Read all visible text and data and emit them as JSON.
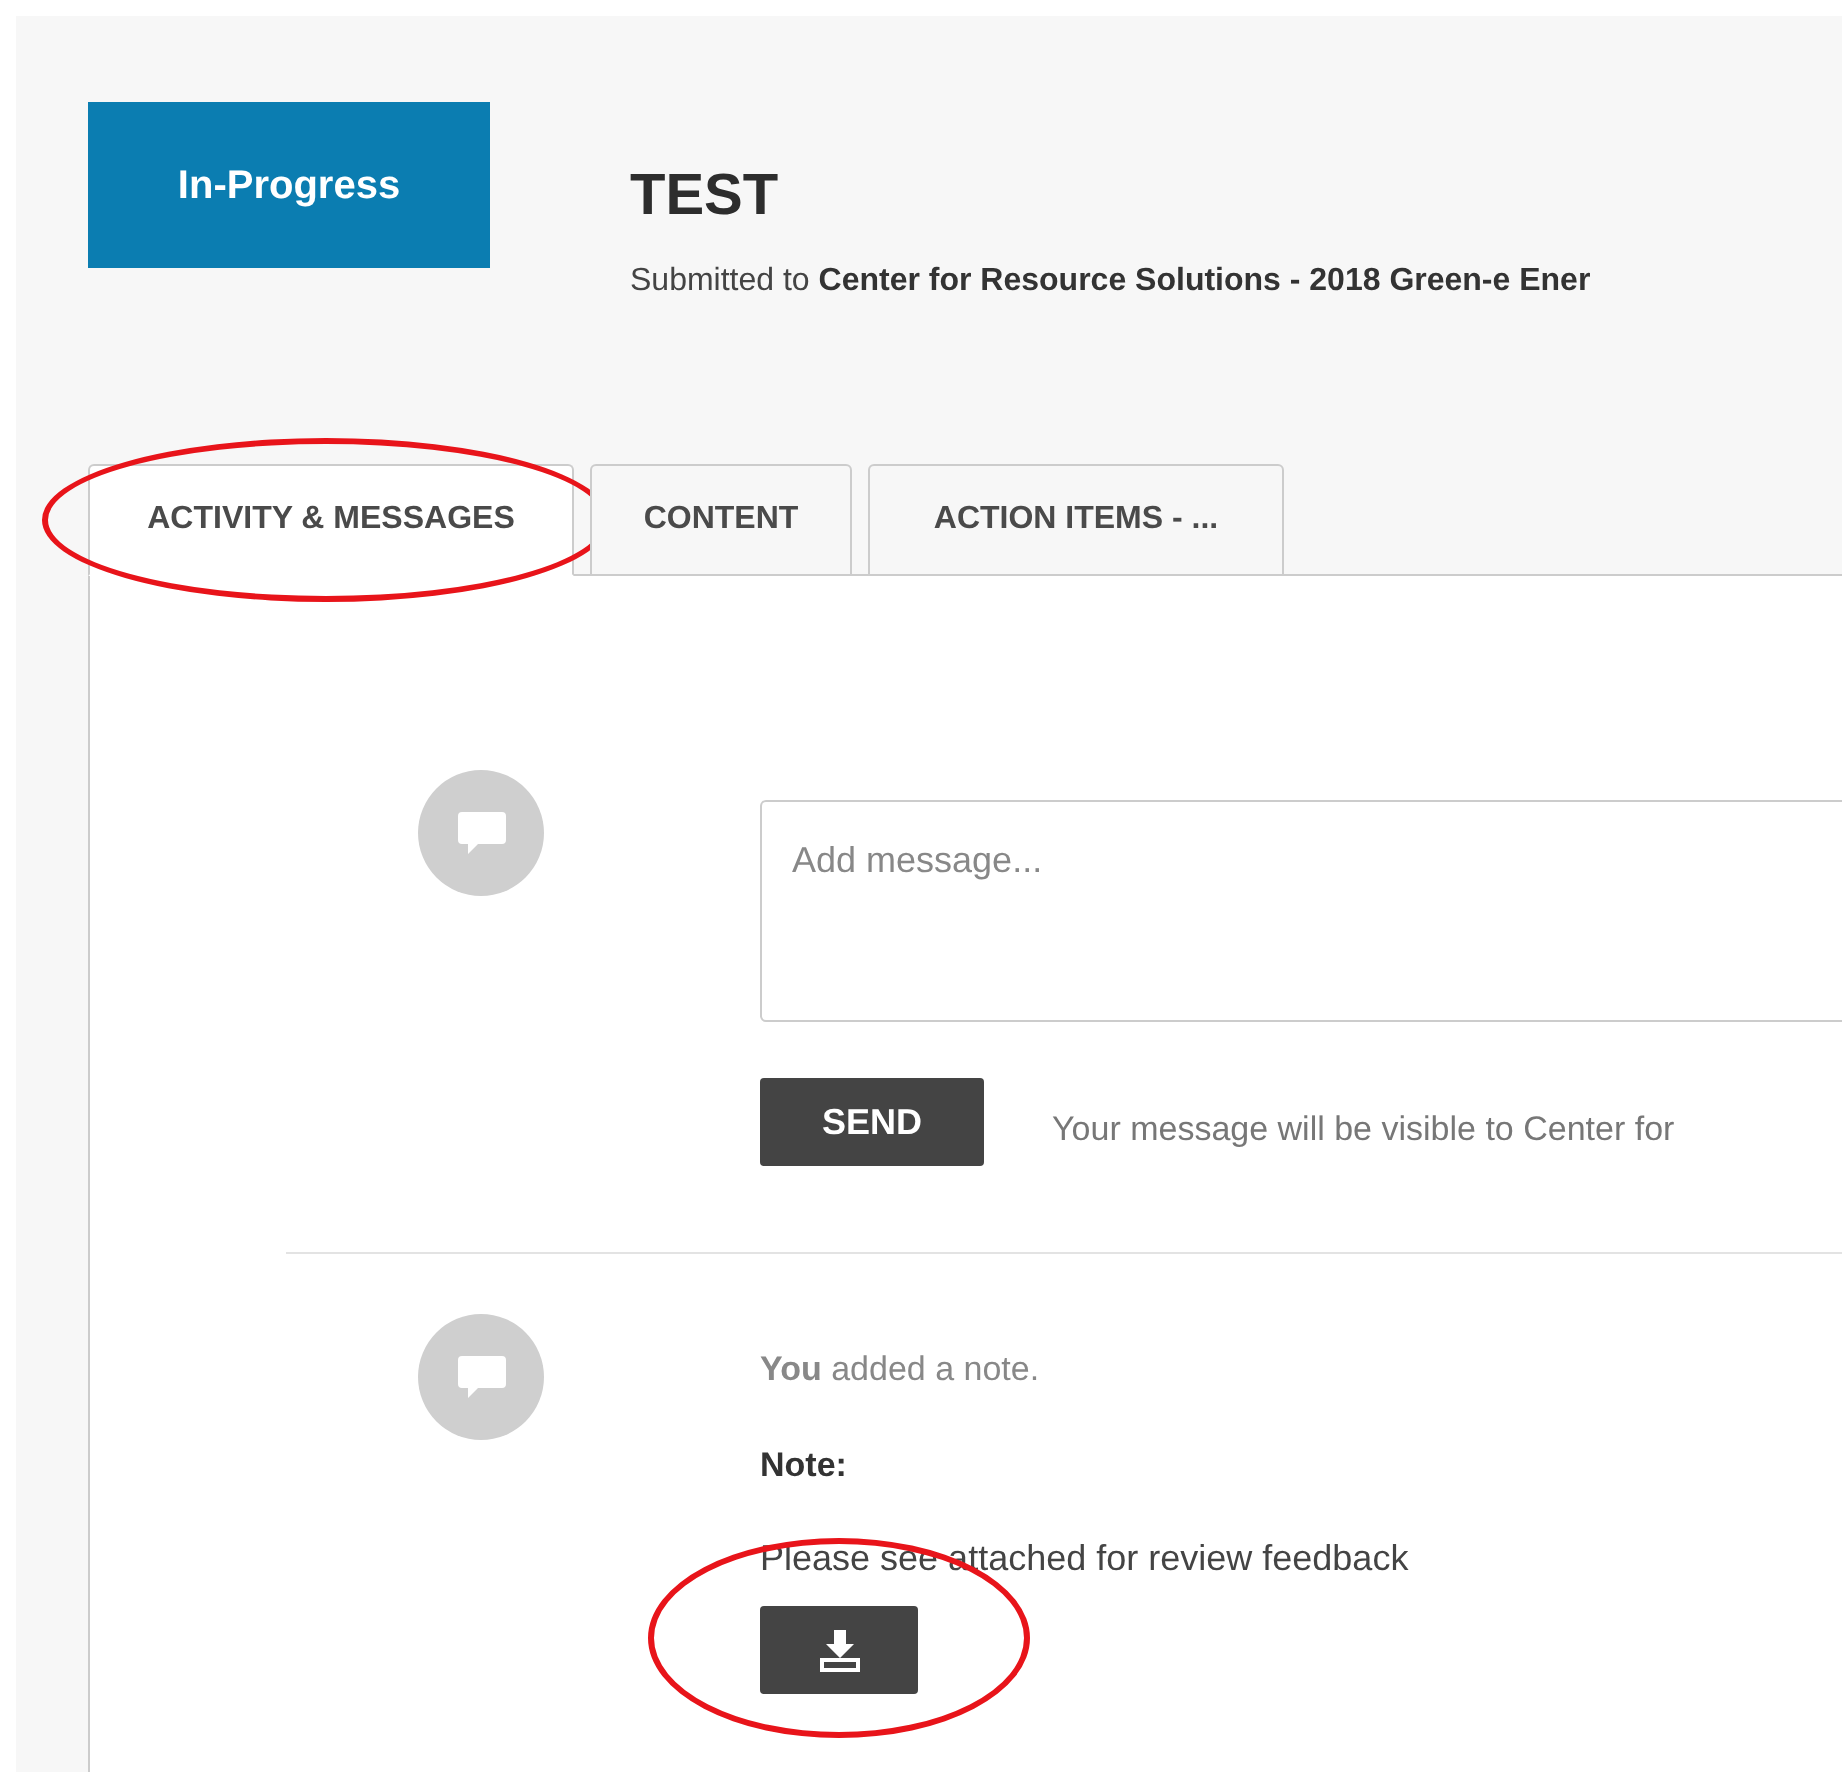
{
  "status_button": {
    "label": "In-Progress"
  },
  "header": {
    "title": "TEST",
    "submitted_prefix": "Submitted to",
    "submitted_to": "Center for Resource Solutions - 2018 Green-e Ener"
  },
  "tabs": [
    {
      "label": "ACTIVITY & MESSAGES",
      "selected": true,
      "annotated": true
    },
    {
      "label": "CONTENT",
      "selected": false,
      "annotated": false
    },
    {
      "label": "ACTION ITEMS - ...",
      "selected": false,
      "annotated": false
    }
  ],
  "composer": {
    "placeholder": "Add message...",
    "send_label": "SEND",
    "hint": "Your message will be visible to Center for"
  },
  "activity": [
    {
      "summary": "**You** added a note.",
      "note_label": "Note:",
      "note_text": "Please see attached for review feedback",
      "attachment_annotated": true
    }
  ]
}
